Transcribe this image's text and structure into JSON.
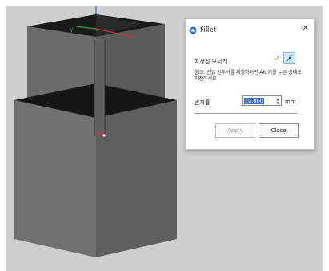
{
  "viewport": {
    "axis_y_label": "y",
    "background": "#cfcfcf",
    "body_color": "#686868",
    "top_face_color": "#1a1a1a"
  },
  "dialog": {
    "icon": "fillet-app-icon",
    "title": "Fillet",
    "close_icon": "close-icon",
    "edge_label": "지정된 모서리",
    "edge_status_icon": "check-icon",
    "select_edge_icon": "select-edge-icon",
    "hint": "참고: 단일 컨투어를 지정하려면 Alt 키를 누른 상태로 지정하세요",
    "radius_label": "반지름",
    "radius_value": "12.000",
    "radius_unit": "mm",
    "apply_label": "Apply",
    "close_label": "Close",
    "accent": "#3b73c6"
  }
}
